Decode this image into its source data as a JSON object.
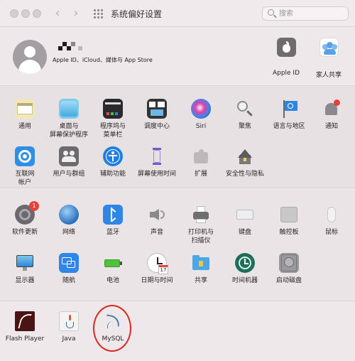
{
  "window": {
    "title": "系统偏好设置",
    "search_placeholder": "搜索"
  },
  "account": {
    "subtitle": "Apple ID、iCloud、媒体与 App Store",
    "items": [
      {
        "label": "Apple ID",
        "icon": "apple-logo-icon"
      },
      {
        "label": "家人共享",
        "icon": "family-sharing-icon"
      }
    ]
  },
  "section1": [
    {
      "id": "general",
      "label": "通用",
      "icon": "general-window-icon",
      "color": "#f2e7b7"
    },
    {
      "id": "desktop",
      "label": "桌面与\n屏幕保护程序",
      "icon": "desktop-screensaver-icon",
      "color": "#7ecbf0"
    },
    {
      "id": "dock",
      "label": "程序坞与\n菜单栏",
      "icon": "dock-menubar-icon",
      "color": "#2a2a2e"
    },
    {
      "id": "mission",
      "label": "调度中心",
      "icon": "mission-control-icon",
      "color": "#333"
    },
    {
      "id": "siri",
      "label": "Siri",
      "icon": "siri-icon",
      "color": "#7a3fd1"
    },
    {
      "id": "spotlight",
      "label": "聚焦",
      "icon": "spotlight-magnifier-icon",
      "color": "#888"
    },
    {
      "id": "language",
      "label": "语言与地区",
      "icon": "language-flag-icon",
      "color": "#2f86e0"
    },
    {
      "id": "notifications",
      "label": "通知",
      "icon": "notification-bell-icon",
      "color": "#e6413b"
    },
    {
      "id": "internet",
      "label": "互联网\n帐户",
      "icon": "internet-accounts-at-icon",
      "color": "#2f8ee6"
    },
    {
      "id": "users",
      "label": "用户与群组",
      "icon": "users-groups-icon",
      "color": "#6b6b6f"
    },
    {
      "id": "accessibility",
      "label": "辅助功能",
      "icon": "accessibility-icon",
      "color": "#1f7fe0"
    },
    {
      "id": "screentime",
      "label": "屏幕使用时间",
      "icon": "screen-time-hourglass-icon",
      "color": "#7a56c8"
    },
    {
      "id": "extensions",
      "label": "扩展",
      "icon": "extensions-puzzle-icon",
      "color": "#b9b6b8"
    },
    {
      "id": "security",
      "label": "安全性与隐私",
      "icon": "security-house-icon",
      "color": "#6e6c6e"
    }
  ],
  "section2": [
    {
      "id": "softwareupdate",
      "label": "软件更新",
      "icon": "software-update-gear-icon",
      "color": "#6a6a6e",
      "badge": "1"
    },
    {
      "id": "network",
      "label": "网络",
      "icon": "network-globe-icon",
      "color": "#2f78c8"
    },
    {
      "id": "bluetooth",
      "label": "蓝牙",
      "icon": "bluetooth-icon",
      "color": "#2f86e6"
    },
    {
      "id": "sound",
      "label": "声音",
      "icon": "sound-speaker-icon",
      "color": "#9a9a9a"
    },
    {
      "id": "printers",
      "label": "打印机与\n扫描仪",
      "icon": "printer-icon",
      "color": "#707070"
    },
    {
      "id": "keyboard",
      "label": "键盘",
      "icon": "keyboard-icon",
      "color": "#cfcfd1"
    },
    {
      "id": "trackpad",
      "label": "触控板",
      "icon": "trackpad-icon",
      "color": "#bdbdbf"
    },
    {
      "id": "mouse",
      "label": "鼠标",
      "icon": "mouse-icon",
      "color": "#e4e4e6"
    },
    {
      "id": "displays",
      "label": "显示器",
      "icon": "display-monitor-icon",
      "color": "#4aa8e8"
    },
    {
      "id": "sidecar",
      "label": "随航",
      "icon": "sidecar-icon",
      "color": "#2f86e6"
    },
    {
      "id": "battery",
      "label": "电池",
      "icon": "battery-icon",
      "color": "#4fc23a"
    },
    {
      "id": "datetime",
      "label": "日期与时间",
      "icon": "clock-calendar-icon",
      "color": "#ffffff",
      "sub": "17"
    },
    {
      "id": "sharing",
      "label": "共享",
      "icon": "sharing-folder-icon",
      "color": "#4aa8e8"
    },
    {
      "id": "timemachine",
      "label": "时间机器",
      "icon": "time-machine-icon",
      "color": "#1d6e5a"
    },
    {
      "id": "startupdisk",
      "label": "启动磁盘",
      "icon": "startup-disk-icon",
      "color": "#9a9a9c"
    }
  ],
  "section3": [
    {
      "id": "flash",
      "label": "Flash Player",
      "icon": "flash-player-icon",
      "color": "#4a1414"
    },
    {
      "id": "java",
      "label": "Java",
      "icon": "java-cup-icon",
      "color": "#f4f4f4"
    },
    {
      "id": "mysql",
      "label": "MySQL",
      "icon": "mysql-dolphin-icon",
      "color": "#e8e1e4"
    }
  ]
}
